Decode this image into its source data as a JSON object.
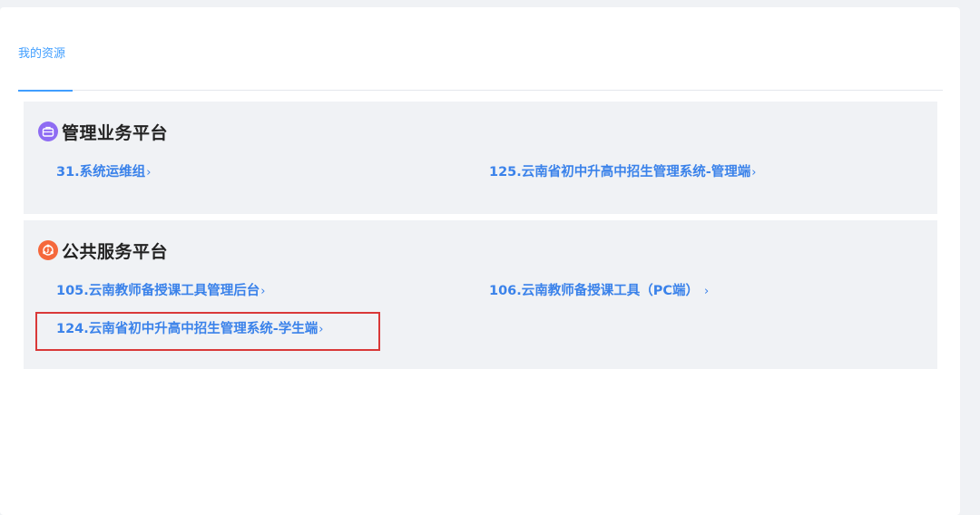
{
  "tabs": [
    {
      "label": "我的资源",
      "active": true
    }
  ],
  "sections": [
    {
      "title": "管理业务平台",
      "icon": "briefcase-icon",
      "icon_color": "#8e6cf3",
      "links": [
        {
          "label": "31.系统运维组"
        },
        {
          "label": "125.云南省初中升高中招生管理系统-管理端"
        }
      ]
    },
    {
      "title": "公共服务平台",
      "icon": "service-hub-icon",
      "icon_color": "#f5683c",
      "links": [
        {
          "label": "105.云南教师备授课工具管理后台"
        },
        {
          "label": "106.云南教师备授课工具（PC端）"
        },
        {
          "label": "124.云南省初中升高中招生管理系统-学生端",
          "highlighted": true
        }
      ]
    }
  ],
  "chevron": "›",
  "colors": {
    "accent": "#409eff",
    "link": "#3a82ea",
    "highlight": "#d93838",
    "section_bg": "#f0f2f5"
  }
}
